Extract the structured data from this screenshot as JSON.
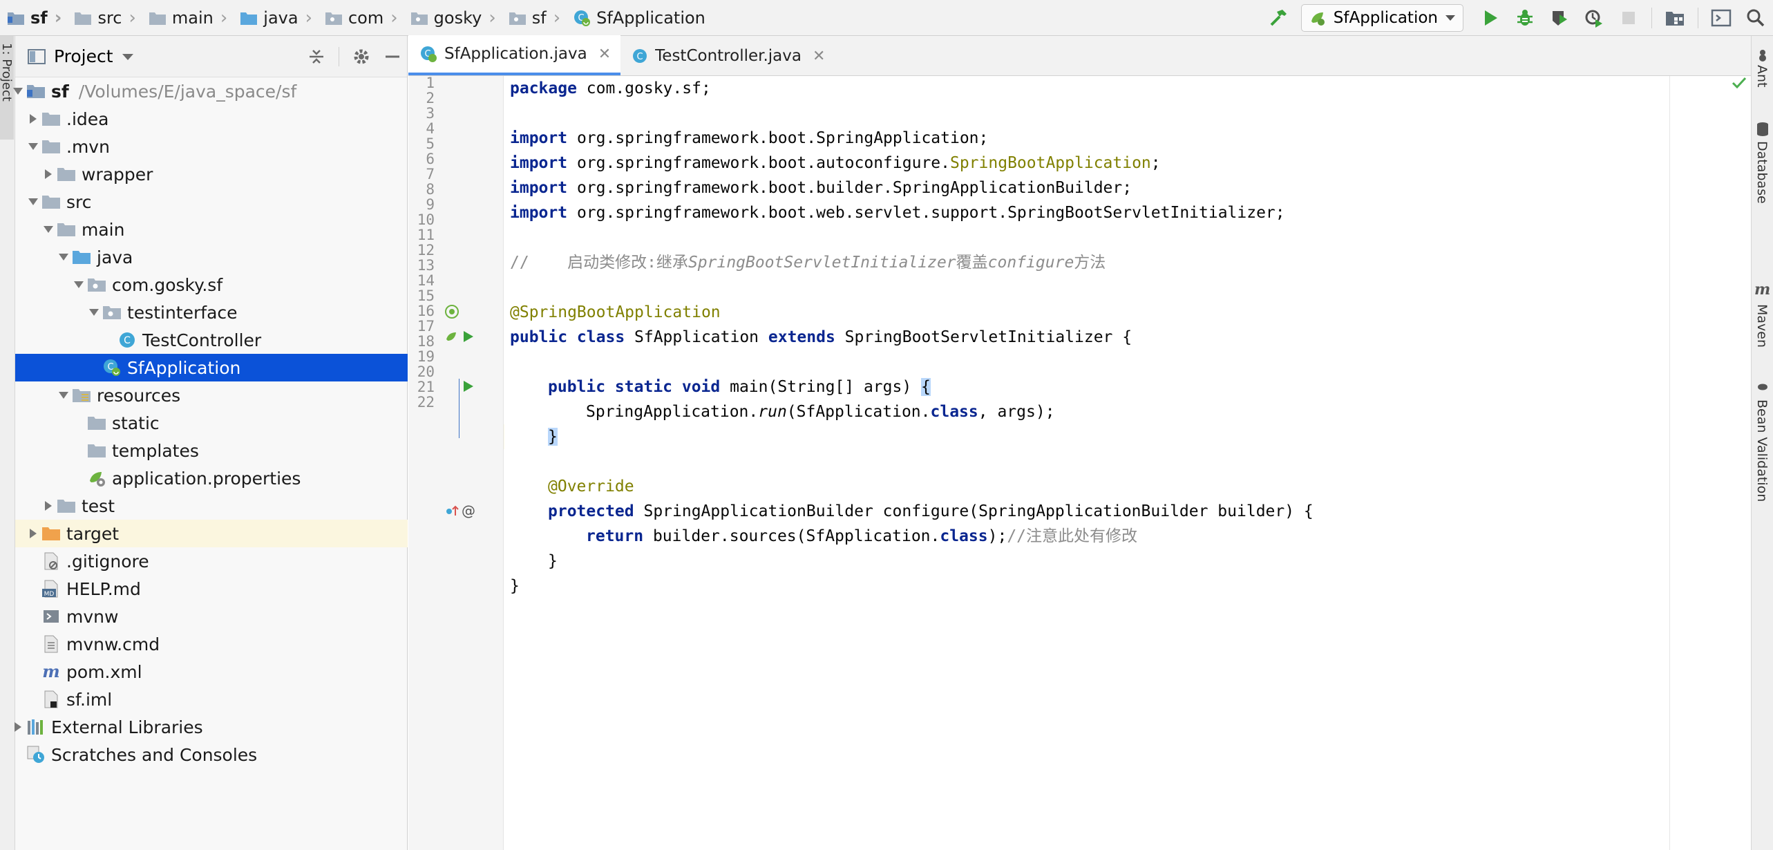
{
  "breadcrumb": [
    "sf",
    "src",
    "main",
    "java",
    "com",
    "gosky",
    "sf",
    "SfApplication"
  ],
  "toolbar": {
    "run_config": "SfApplication"
  },
  "left_strip": {
    "label": "1: Project"
  },
  "project_panel": {
    "title": "Project",
    "tree": [
      {
        "label": "sf",
        "path": "/Volumes/E/java_space/sf",
        "icon": "module-folder-icon",
        "expanded": true
      },
      {
        "label": ".idea",
        "icon": "folder-icon"
      },
      {
        "label": ".mvn",
        "icon": "folder-icon",
        "expanded": true
      },
      {
        "label": "wrapper",
        "icon": "folder-icon"
      },
      {
        "label": "src",
        "icon": "folder-icon",
        "expanded": true
      },
      {
        "label": "main",
        "icon": "folder-icon",
        "expanded": true
      },
      {
        "label": "java",
        "icon": "source-folder-icon",
        "expanded": true
      },
      {
        "label": "com.gosky.sf",
        "icon": "package-icon",
        "expanded": true
      },
      {
        "label": "testinterface",
        "icon": "package-icon",
        "expanded": true
      },
      {
        "label": "TestController",
        "icon": "class-icon"
      },
      {
        "label": "SfApplication",
        "icon": "spring-boot-class-icon",
        "selected": true
      },
      {
        "label": "resources",
        "icon": "resources-folder-icon",
        "expanded": true
      },
      {
        "label": "static",
        "icon": "folder-icon"
      },
      {
        "label": "templates",
        "icon": "folder-icon"
      },
      {
        "label": "application.properties",
        "icon": "spring-properties-icon"
      },
      {
        "label": "test",
        "icon": "folder-icon"
      },
      {
        "label": "target",
        "icon": "excluded-folder-icon"
      },
      {
        "label": ".gitignore",
        "icon": "ignore-file-icon"
      },
      {
        "label": "HELP.md",
        "icon": "markdown-icon"
      },
      {
        "label": "mvnw",
        "icon": "shell-icon"
      },
      {
        "label": "mvnw.cmd",
        "icon": "text-file-icon"
      },
      {
        "label": "pom.xml",
        "icon": "maven-icon"
      },
      {
        "label": "sf.iml",
        "icon": "iml-file-icon"
      },
      {
        "label": "External Libraries",
        "icon": "libraries-icon"
      },
      {
        "label": "Scratches and Consoles",
        "icon": "scratches-icon"
      }
    ]
  },
  "editor": {
    "tabs": [
      {
        "label": "SfApplication.java",
        "active": true
      },
      {
        "label": "TestController.java",
        "active": false
      }
    ],
    "line_numbers": [
      "1",
      "2",
      "3",
      "4",
      "5",
      "6",
      "7",
      "8",
      "9",
      "10",
      "11",
      "12",
      "13",
      "14",
      "15",
      "16",
      "17",
      "18",
      "19",
      "20",
      "21",
      "22"
    ],
    "code": {
      "l1_kw": "package",
      "l1_rest": " com.gosky.sf;",
      "l3_kw": "import",
      "l3_rest": " org.springframework.boot.SpringApplication;",
      "l4_kw": "import",
      "l4_a": " org.springframework.boot.autoconfigure.",
      "l4_ann": "SpringBootApplication",
      "l4_b": ";",
      "l5_kw": "import",
      "l5_rest": " org.springframework.boot.builder.SpringApplicationBuilder;",
      "l6_kw": "import",
      "l6_rest": " org.springframework.boot.web.servlet.support.SpringBootServletInitializer;",
      "l8_a": "//    启动类修改:继承",
      "l8_b": "SpringBootServletInitializer",
      "l8_c": "覆盖",
      "l8_d": "configure",
      "l8_e": "方法",
      "l10_ann": "@SpringBootApplication",
      "l11_kw1": "public class",
      "l11_a": " SfApplication ",
      "l11_kw2": "extends",
      "l11_b": " SpringBootServletInitializer {",
      "l13_kw": "public static void",
      "l13_a": " main(String[] args) ",
      "l13_brace": "{",
      "l14_a": "SpringApplication.",
      "l14_it": "run",
      "l14_b": "(SfApplication.",
      "l14_kw": "class",
      "l14_c": ", args);",
      "l15_brace": "}",
      "l17_ann": "@Override",
      "l18_kw": "protected",
      "l18_rest": " SpringApplicationBuilder configure(SpringApplicationBuilder builder) {",
      "l19_kw": "return",
      "l19_a": " builder.sources(SfApplication.",
      "l19_kw2": "class",
      "l19_b": ");",
      "l19_cmt": "//注意此处有修改",
      "l20": "}",
      "l21": "}"
    }
  },
  "right_strip": [
    "Ant",
    "Database",
    "Maven",
    "Bean Validation"
  ],
  "colors": {
    "selection": "#0b52d8",
    "keyword": "#0a2690",
    "annotation": "#808000",
    "comment": "#8c8c8c",
    "caret_line": "#fdfbe8",
    "run_green": "#3aa23a"
  }
}
